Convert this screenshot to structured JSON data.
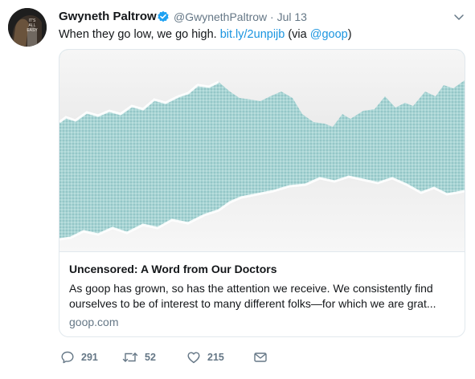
{
  "tweet": {
    "author": {
      "name": "Gwyneth Paltrow",
      "handle": "@GwynethPaltrow",
      "separator": " · ",
      "date": "Jul 13",
      "avatar_text": "IT'S ALL EASY"
    },
    "text": {
      "main": "When they go low, we go high. ",
      "link": "bit.ly/2unpijb",
      "via_prefix": " (via ",
      "mention": "@goop",
      "via_suffix": ")"
    },
    "card": {
      "title": "Uncensored: A Word from Our Doctors",
      "description": "As goop has grown, so has the attention we receive. We consistently find ourselves to be of interest to many different folks—for which we are grat...",
      "domain": "goop.com"
    },
    "actions": {
      "replies": "291",
      "retweets": "52",
      "likes": "215"
    },
    "icons": [
      "verified-icon",
      "caret-down-icon",
      "reply-icon",
      "retweet-icon",
      "like-icon",
      "message-icon"
    ],
    "colors": {
      "link": "#1b95e0",
      "secondary_text": "#657786",
      "verified": "#1da1f2"
    }
  }
}
